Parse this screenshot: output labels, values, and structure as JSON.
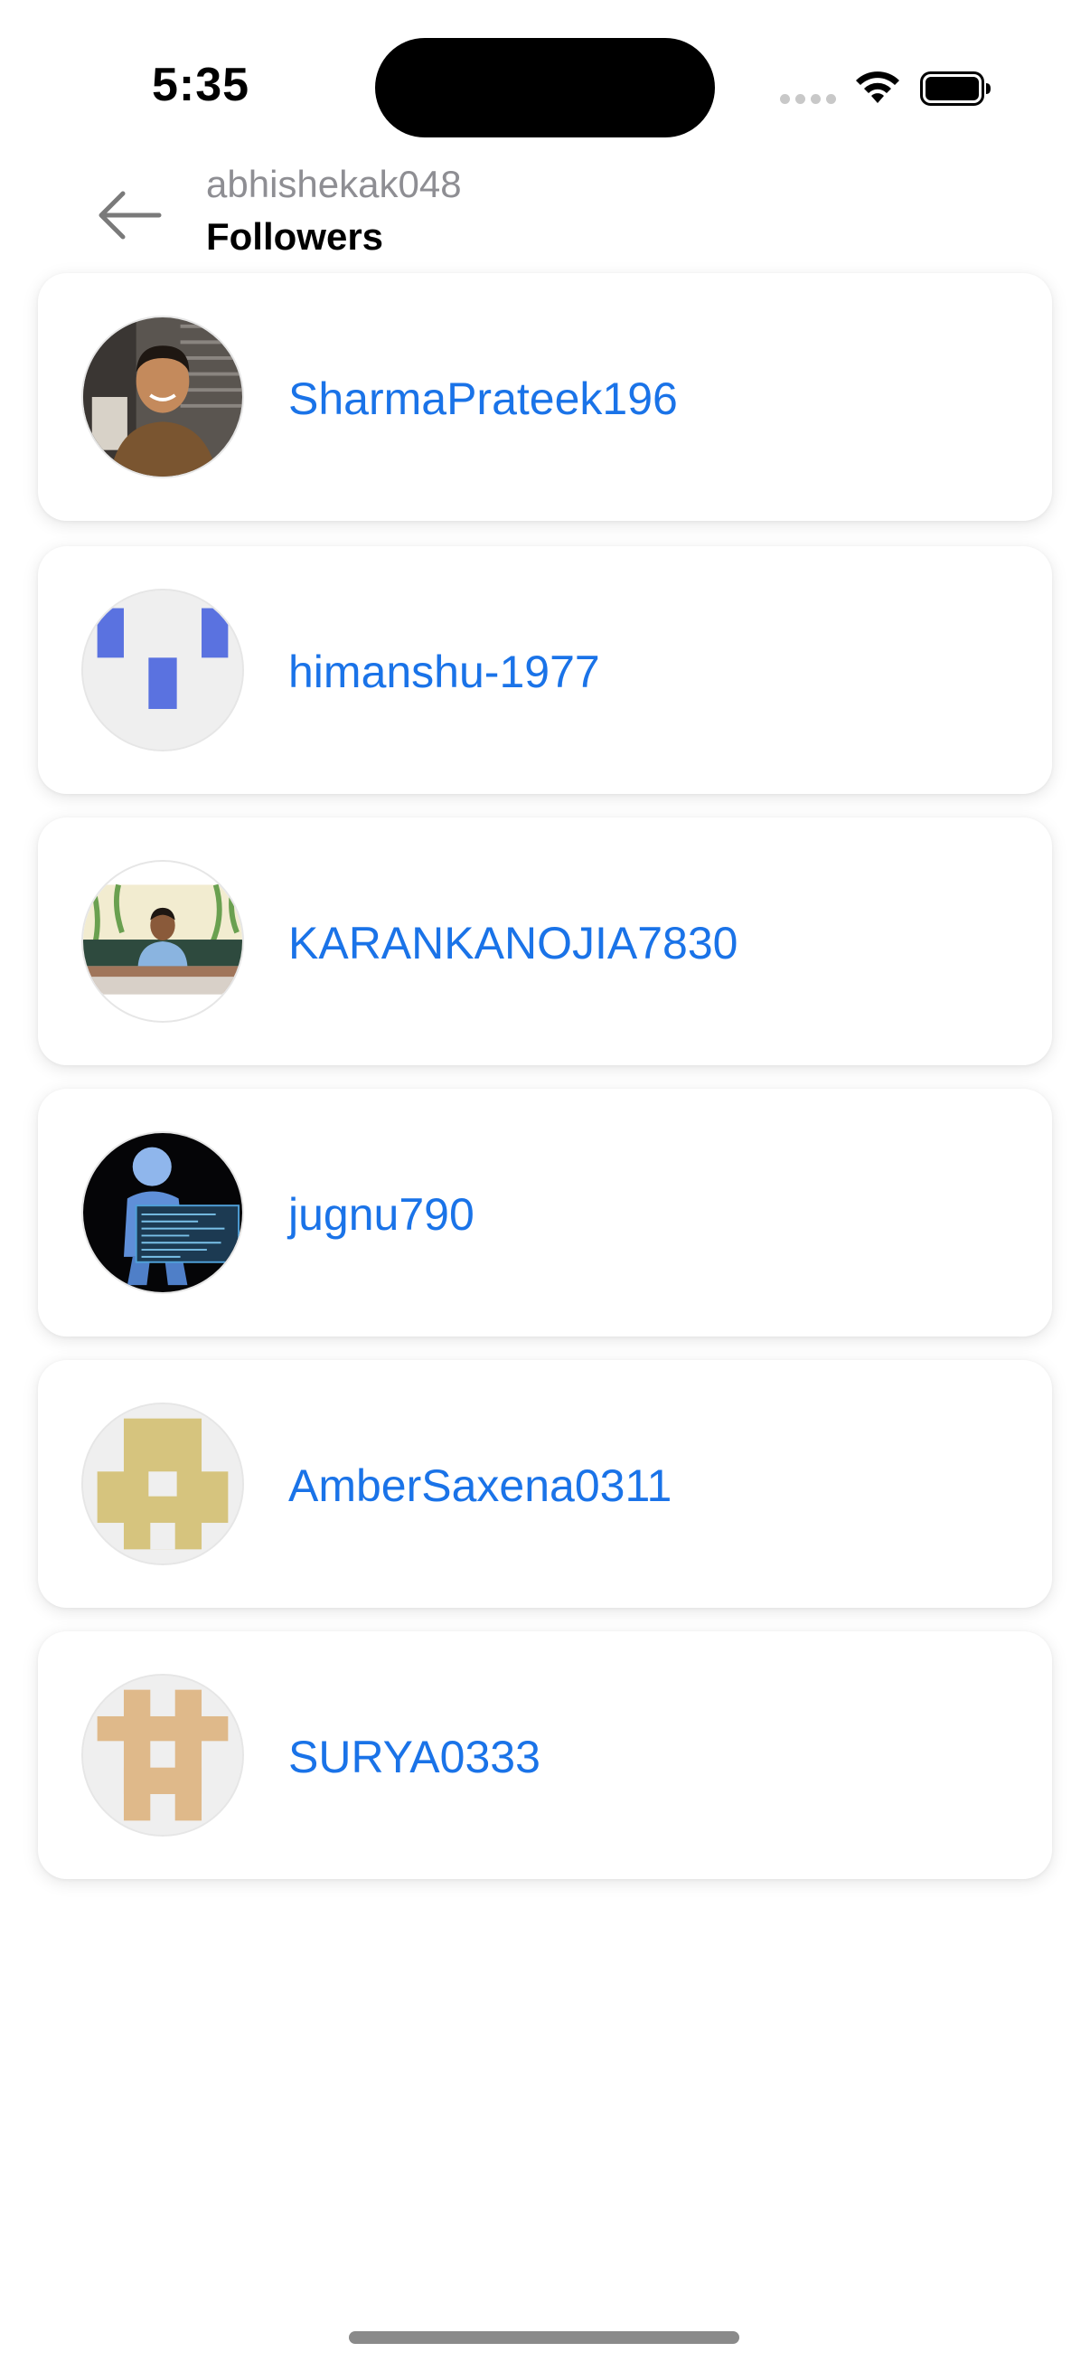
{
  "status_bar": {
    "time": "5:35"
  },
  "header": {
    "username": "abhishekak048",
    "title": "Followers"
  },
  "followers": [
    {
      "username": "SharmaPrateek196",
      "avatar": "photo-man-smiling"
    },
    {
      "username": "himanshu-1977",
      "avatar": "identicon-blue"
    },
    {
      "username": "KARANKANOJIA7830",
      "avatar": "photo-man-sitting"
    },
    {
      "username": "jugnu790",
      "avatar": "figure-holding-screen"
    },
    {
      "username": "AmberSaxena0311",
      "avatar": "identicon-khaki"
    },
    {
      "username": "SURYA0333",
      "avatar": "identicon-tan"
    }
  ],
  "colors": {
    "link": "#1a73e8",
    "identicon_blue": "#5a72e0",
    "identicon_khaki": "#d6c47e",
    "identicon_tan": "#dfb98a"
  }
}
